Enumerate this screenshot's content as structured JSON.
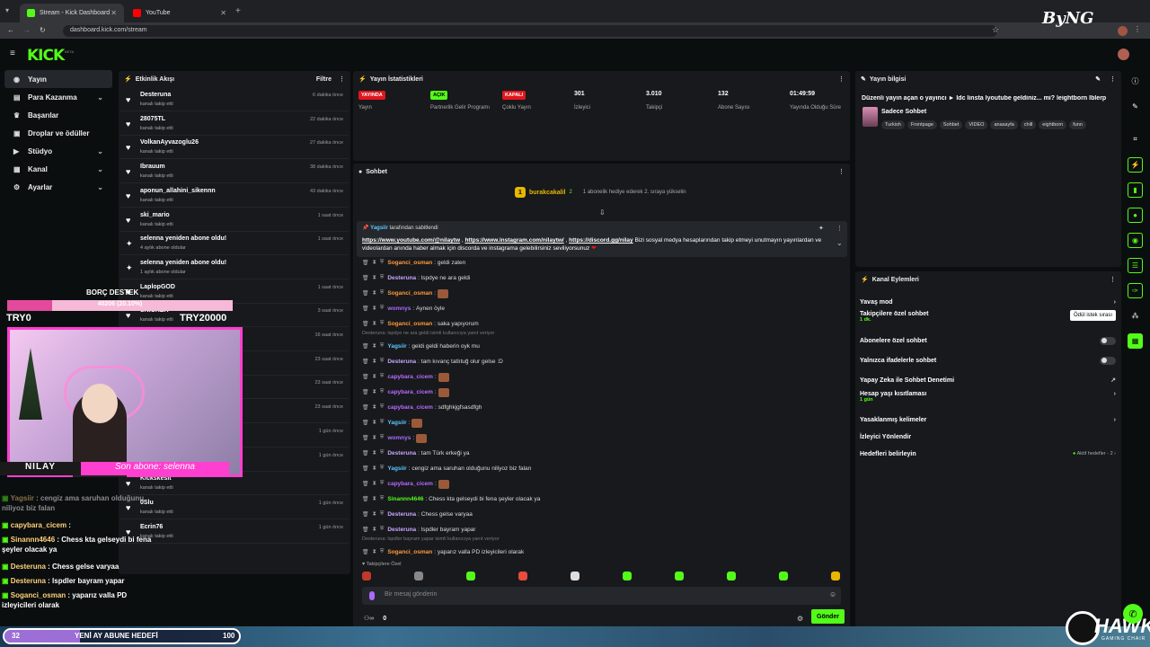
{
  "browser": {
    "tabs": [
      {
        "title": "Stream - Kick Dashboard"
      },
      {
        "title": "YouTube"
      }
    ],
    "url": "dashboard.kick.com/stream"
  },
  "kick": {
    "logo": "KICK",
    "beta": "BETA"
  },
  "sidebar": {
    "items": [
      {
        "label": "Yayın",
        "icon": "broadcast-icon"
      },
      {
        "label": "Para Kazanma",
        "icon": "money-icon"
      },
      {
        "label": "Başarılar",
        "icon": "trophy-icon"
      },
      {
        "label": "Droplar ve ödüller",
        "icon": "gift-icon"
      },
      {
        "label": "Stüdyo",
        "icon": "studio-icon"
      },
      {
        "label": "Kanal",
        "icon": "channel-icon"
      },
      {
        "label": "Ayarlar",
        "icon": "gear-icon"
      }
    ]
  },
  "activity": {
    "title": "Etkinlik Akışı",
    "filter": "Filtre",
    "items": [
      {
        "name": "Desteruna",
        "sub": "kanalı takip etti",
        "time": "6 dakika önce"
      },
      {
        "name": "28075TL",
        "sub": "kanalı takip etti",
        "time": "22 dakika önce"
      },
      {
        "name": "VolkanAyvazoglu26",
        "sub": "kanalı takip etti",
        "time": "27 dakika önce"
      },
      {
        "name": "Ibrauum",
        "sub": "kanalı takip etti",
        "time": "38 dakika önce"
      },
      {
        "name": "aponun_allahini_sikennn",
        "sub": "kanalı takip etti",
        "time": "43 dakika önce"
      },
      {
        "name": "ski_mario",
        "sub": "kanalı takip etti",
        "time": "1 saat önce"
      },
      {
        "name": "selenna yeniden abone oldu!",
        "sub": "4 aylık abone oldular",
        "time": "1 saat önce"
      },
      {
        "name": "selenna yeniden abone oldu!",
        "sub": "1 aylık abone oldular",
        "time": ""
      },
      {
        "name": "LaplopGOD",
        "sub": "kanalı takip etti",
        "time": "1 saat önce"
      },
      {
        "name": "SNICKER",
        "sub": "kanalı takip etti",
        "time": "3 saat önce"
      },
      {
        "name": "",
        "sub": "",
        "time": "16 saat önce"
      },
      {
        "name": "",
        "sub": "hediye etti.",
        "time": "23 saat önce"
      },
      {
        "name": "",
        "sub": "hediye etti.",
        "time": "23 saat önce"
      },
      {
        "name": "",
        "sub": "",
        "time": "23 saat önce"
      },
      {
        "name": "",
        "sub": "",
        "time": "1 gün önce"
      },
      {
        "name": "",
        "sub": "",
        "time": "1 gün önce"
      },
      {
        "name": "Kickskesit",
        "sub": "kanalı takip etti",
        "time": ""
      },
      {
        "name": "0Slu",
        "sub": "kanalı takip etti",
        "time": "1 gün önce"
      },
      {
        "name": "Ecrin76",
        "sub": "kanalı takip etti",
        "time": "1 gün önce"
      }
    ]
  },
  "stats": {
    "title": "Yayın İstatistikleri",
    "items": [
      {
        "badge": "YAYINDA",
        "label": "Yayın",
        "color": "#e0161d"
      },
      {
        "badge": "AÇIK",
        "label": "Partnerlik Gelir Programı",
        "color": "#53fc18"
      },
      {
        "badge": "KAPALI",
        "label": "Çoklu Yayın",
        "color": "#e0161d"
      },
      {
        "value": "301",
        "label": "İzleyici"
      },
      {
        "value": "3.010",
        "label": "Takipçi"
      },
      {
        "value": "132",
        "label": "Abone Sayısı"
      },
      {
        "value": "01:49:59",
        "label": "Yayında Olduğu Süre"
      }
    ]
  },
  "chat": {
    "title": "Sohbet",
    "gift": {
      "user": "burakcakalil",
      "count": "2",
      "text": "1 abonelik hediye ederek 2. sıraya yükselin"
    },
    "pinned": {
      "by": "Yagsiir",
      "by_text": "tarafından sabitlendi",
      "links": [
        "https://www.youtube.com/@nilaytw",
        "https://www.instagram.com/nilaytw/",
        "https://discord.gg/nilay"
      ],
      "text": "Bizi sosyal medya hesaplarından takip etmeyi unutmayın yayınlardan ve videolardan anında haber almak için discorda ve instagrama gelebilirsiniz seviliyorsunuz"
    },
    "messages": [
      {
        "user": "Soganci_osman",
        "text": "geldi zaten",
        "color": "#ff9a3c"
      },
      {
        "user": "Desteruna",
        "text": "lspdye ne ara geldi",
        "color": "#c8a6ff"
      },
      {
        "user": "Soganci_osman",
        "text": "",
        "color": "#ff9a3c"
      },
      {
        "user": "womnys",
        "text": "Aynen öyle",
        "color": "#a86bff"
      },
      {
        "user": "Soganci_osman",
        "text": "saka yapıyorum",
        "color": "#ff9a3c"
      },
      {
        "user": "Yagsiir",
        "text": "geldi geldi haberin oyk mu",
        "color": "#5ac8ff"
      },
      {
        "user": "Desteruna",
        "text": "tam kıvanç tatlıtuğ olur gelse :D",
        "color": "#c8a6ff"
      },
      {
        "user": "capybara_cicem",
        "text": "",
        "color": "#b86bff"
      },
      {
        "user": "capybara_cicem",
        "text": "",
        "color": "#b86bff"
      },
      {
        "user": "capybara_cicem",
        "text": "sdfghkjgfsasdfgh",
        "color": "#b86bff"
      },
      {
        "user": "Yagsiir",
        "text": "",
        "color": "#5ac8ff"
      },
      {
        "user": "womnys",
        "text": "",
        "color": "#a86bff"
      },
      {
        "user": "Desteruna",
        "text": "tam Türk erkeği ya",
        "color": "#c8a6ff"
      },
      {
        "user": "Yagsiir",
        "text": "cengiz ama saruhan olduğunu niliyoz biz falan",
        "color": "#5ac8ff"
      },
      {
        "user": "capybara_cicem",
        "text": "",
        "color": "#b86bff"
      },
      {
        "user": "Sinannn4646",
        "text": "Chess kta gelseydi bi fena şeyler olacak ya",
        "color": "#53fc18"
      },
      {
        "user": "Desteruna",
        "text": "Chess gelse varyaa",
        "color": "#c8a6ff"
      },
      {
        "user": "Desteruna",
        "text": "lspdler bayram yapar",
        "color": "#c8a6ff"
      },
      {
        "user": "Soganci_osman",
        "text": "yaparız valla PD izleyicileri olarak",
        "color": "#ff9a3c"
      }
    ],
    "notes": [
      "Desteruna: lspdye ne ara geldi isimli kullanıcıya yanıt veriyor",
      "Desteruna: lspdler bayram yapar isimli kullanıcıya yanıt veriyor"
    ],
    "followers_only": "Takipçilere Özel",
    "input_placeholder": "Bir mesaj gönderin",
    "points": "0",
    "send": "Gönder"
  },
  "info": {
    "title": "Yayın bilgisi",
    "stream_title": "Düzenli yayın açan o yayıncı ► ldc linsta lyoutube geldiniz... mi? leightborn lblerp",
    "category": "Sadece Sohbet",
    "tags": [
      "Turkish",
      "Frontpage",
      "Sohbet",
      "VIDEO",
      "anasayfa",
      "chill",
      "eightborn",
      "funn"
    ]
  },
  "actions": {
    "title": "Kanal Eylemleri",
    "rows": [
      {
        "label": "Yavaş mod",
        "sub": ""
      },
      {
        "label": "Takipçilere özel sohbet",
        "sub": "1 dk."
      },
      {
        "label": "Abonelere özel sohbet",
        "sub": ""
      },
      {
        "label": "Yalnızca ifadelerle sohbet",
        "sub": ""
      },
      {
        "label": "Yapay Zeka ile Sohbet Denetimi",
        "sub": ""
      },
      {
        "label": "Hesap yaşı kısıtlaması",
        "sub": "1 gün"
      },
      {
        "label": "Yasaklanmış kelimeler",
        "sub": ""
      },
      {
        "label": "İzleyici Yönlendir",
        "sub": ""
      },
      {
        "label": "Hedefleri belirleyin",
        "sub": "",
        "right": "Aktif hedefler - 2"
      }
    ],
    "tooltip": "Ödül istek sırası"
  },
  "overlay": {
    "goal_label": "BORÇ DESTEK",
    "goal_progress": "40206 (20.10%)",
    "goal_min": "TRY0",
    "goal_max": "TRY20000",
    "goal_fraction": 0.201,
    "streamer_name": "NILAY",
    "last_sub": "Son abone: selenna",
    "chat": [
      {
        "user": "Yagsiir",
        "text": "cengiz ama saruhan olduğunu niliyoz biz falan"
      },
      {
        "user": "capybara_cicem",
        "text": ""
      },
      {
        "user": "Sinannn4646",
        "text": "Chess kta gelseydi bi fena şeyler olacak ya"
      },
      {
        "user": "Desteruna",
        "text": "Chess gelse varyaa"
      },
      {
        "user": "Desteruna",
        "text": "lspdler bayram yapar"
      },
      {
        "user": "Soganci_osman",
        "text": "yaparız valla PD izleyicileri olarak"
      }
    ],
    "sub_goal_left": "32",
    "sub_goal_label": "YENİ AY ABUNE HEDEFİ",
    "sub_goal_right": "100",
    "sub_goal_fraction": 0.32,
    "watermark": "ByNG",
    "hawk": "HAWK",
    "hawk_sub": "GAMING CHAIR"
  },
  "colors": {
    "accent": "#53fc18",
    "live": "#e0161d"
  }
}
